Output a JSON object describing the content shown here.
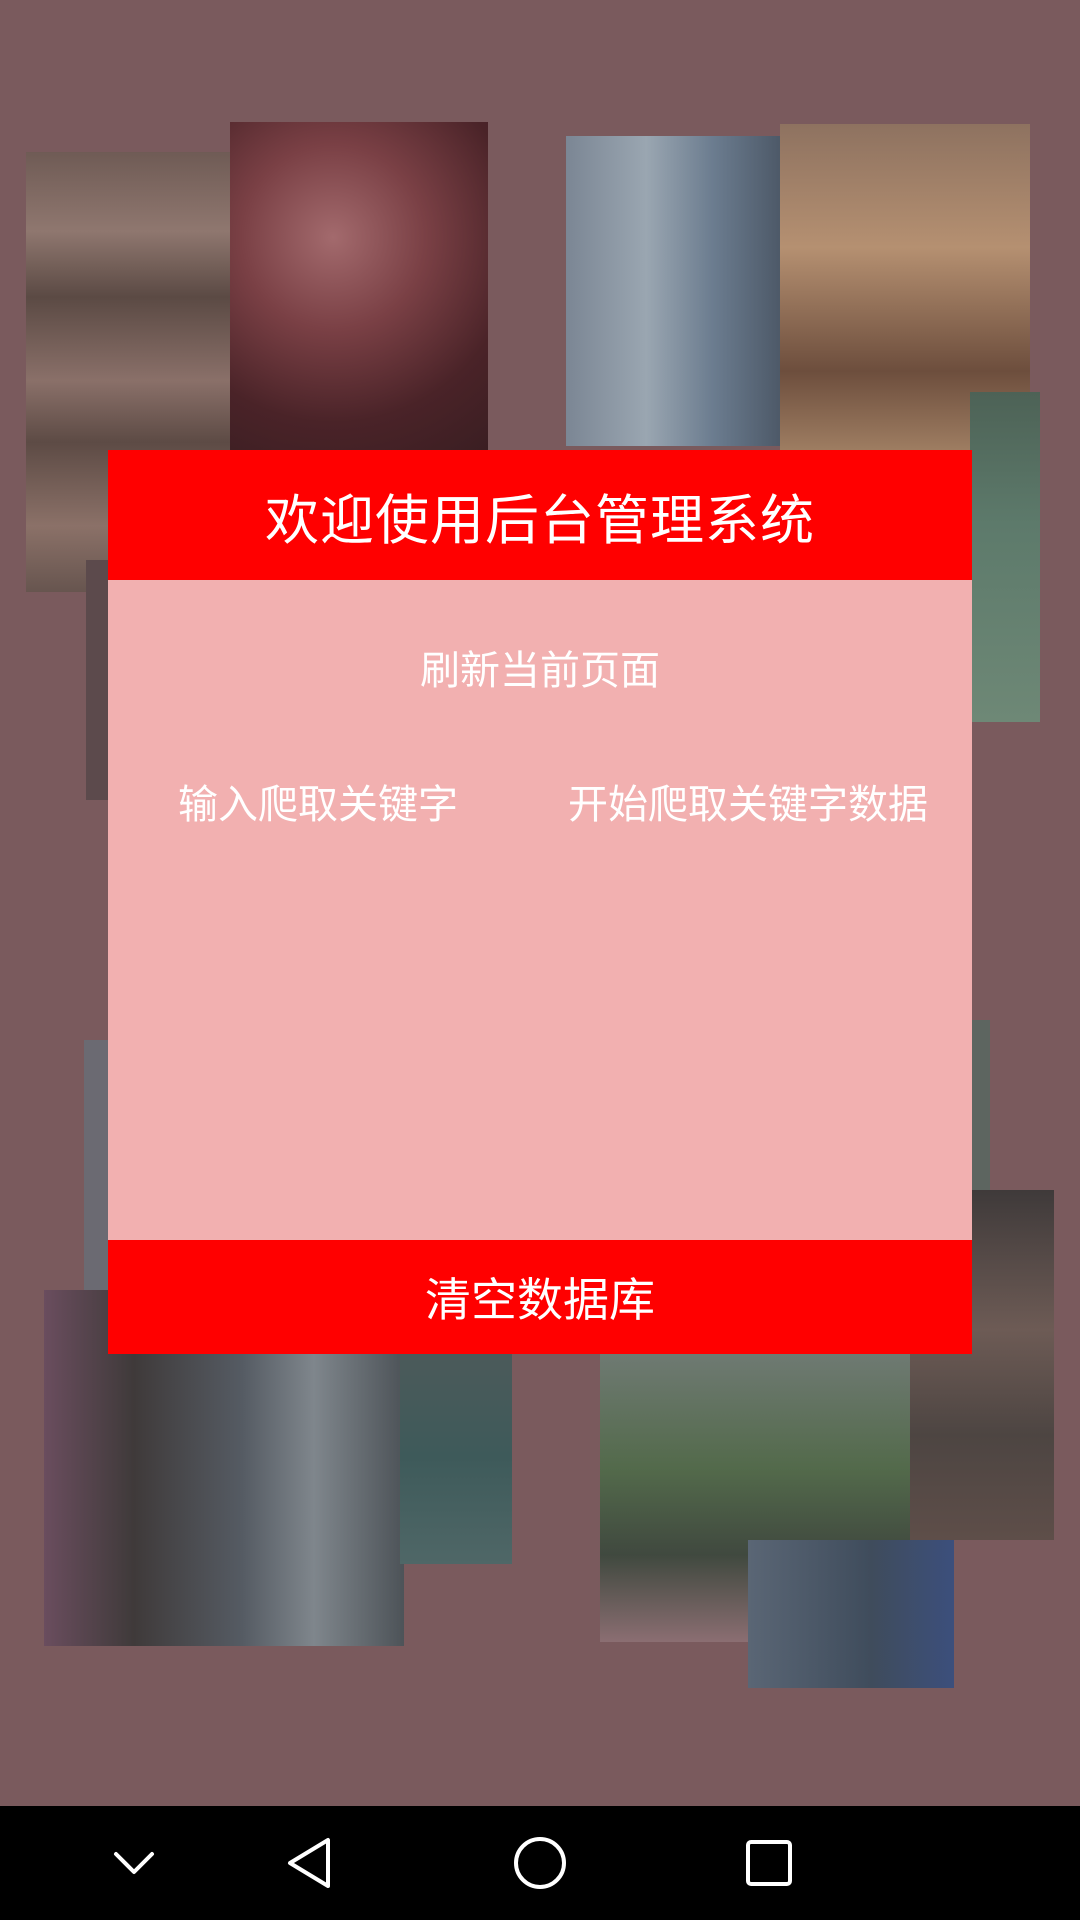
{
  "dialog": {
    "title": "欢迎使用后台管理系统",
    "refresh_label": "刷新当前页面",
    "input_keyword_label": "输入爬取关键字",
    "start_crawl_label": "开始爬取关键字数据",
    "clear_db_label": "清空数据库"
  },
  "navigation_bar": {
    "buttons": [
      {
        "icon": "chevron-down-icon"
      },
      {
        "icon": "back-triangle-icon"
      },
      {
        "icon": "home-circle-icon"
      },
      {
        "icon": "recents-square-icon"
      }
    ]
  },
  "colors": {
    "background": "#7a5a5d",
    "dialog_header": "#ff0000",
    "dialog_body": "#f2b0b0",
    "dialog_footer": "#ff0000",
    "dialog_text": "#ffffff",
    "nav_bar": "#000000",
    "nav_icon": "#ffffff"
  }
}
